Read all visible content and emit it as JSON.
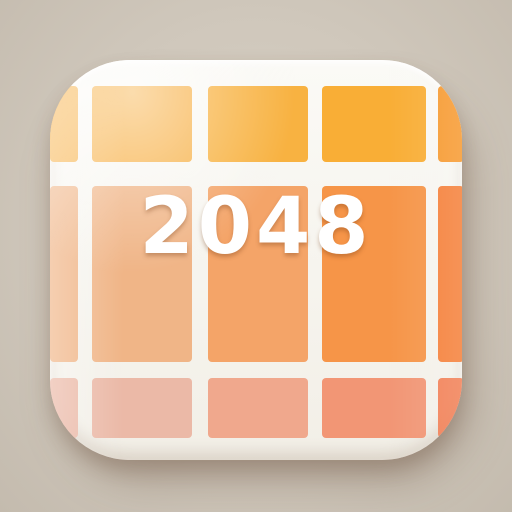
{
  "icon": {
    "title": "2048",
    "grid": {
      "rows": 3,
      "cols": 4,
      "tile_colors": [
        [
          "#f7b24a",
          "#f8b241",
          "#f9ae36",
          "#f79a30"
        ],
        [
          "#f0b587",
          "#f4a468",
          "#f69548",
          "#f5803a"
        ],
        [
          "#eab2a0",
          "#f0a083",
          "#f28c68",
          "#f27447"
        ]
      ]
    },
    "colors": {
      "background": "#cfc7bb",
      "frame": "#f4f1ea",
      "text": "#ffffff"
    }
  }
}
